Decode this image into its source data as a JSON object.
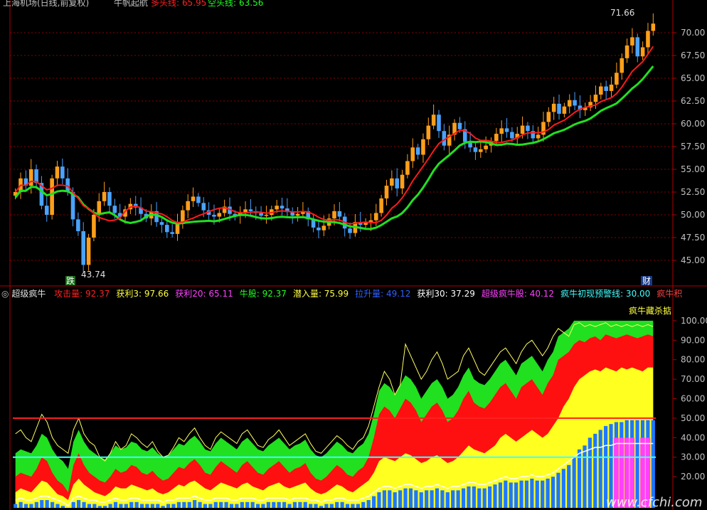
{
  "header": {
    "title": "上海机场(日线,前复权)",
    "indicator": "牛帆起航",
    "bull_label": "多头线:",
    "bull_value": "65.95",
    "bear_label": "空头线:",
    "bear_value": "63.56"
  },
  "sub_header": {
    "name": "超级疯牛",
    "items": [
      {
        "label": "攻击量:",
        "value": "92.37",
        "color": "#ff2020"
      },
      {
        "label": "获利3:",
        "value": "97.66",
        "color": "#ffff40"
      },
      {
        "label": "获利20:",
        "value": "65.11",
        "color": "#ff40ff"
      },
      {
        "label": "牛股:",
        "value": "92.37",
        "color": "#20ff20"
      },
      {
        "label": "潜入量:",
        "value": "75.99",
        "color": "#ffff40"
      },
      {
        "label": "拉升量:",
        "value": "49.12",
        "color": "#3060ff"
      },
      {
        "label": "获利30:",
        "value": "37.29",
        "color": "#ffffff"
      },
      {
        "label": "超级疯牛股:",
        "value": "40.12",
        "color": "#ff40ff"
      },
      {
        "label": "疯牛初现预警线:",
        "value": "30.00",
        "color": "#40ffff"
      },
      {
        "label": "疯牛积",
        "value": "",
        "color": "#ff4040"
      }
    ]
  },
  "annotations": {
    "high_label": "71.66",
    "low_label": "43.74",
    "die_marker": "跌",
    "cai_marker": "财",
    "sub_marker": "疯牛藏杀掂",
    "watermark": "www.cfchi.com"
  },
  "colors": {
    "up": "#ff9f1a",
    "down": "#4aa3ff",
    "bull": "#ff1a1a",
    "bear": "#20e020",
    "grid": "#8a0000",
    "axis": "#b00000"
  },
  "chart_data": [
    {
      "type": "candlestick",
      "title": "上海机场(日线,前复权)",
      "y_ticks": [
        "45.00",
        "47.50",
        "50.00",
        "52.50",
        "55.00",
        "57.50",
        "60.00",
        "62.50",
        "65.00",
        "67.50",
        "70.00"
      ],
      "ylim": [
        42.5,
        72.5
      ],
      "grid": true,
      "close": [
        52.5,
        54.0,
        53.2,
        55.0,
        53.5,
        51.0,
        50.0,
        54.0,
        55.3,
        54.0,
        52.5,
        49.5,
        48.2,
        44.5,
        47.5,
        50.0,
        51.5,
        52.5,
        51.0,
        50.2,
        49.8,
        50.6,
        51.2,
        50.8,
        50.1,
        49.6,
        50.4,
        49.2,
        48.9,
        48.1,
        47.9,
        49.0,
        50.5,
        51.5,
        52.0,
        51.3,
        50.5,
        50.0,
        49.8,
        50.2,
        50.9,
        50.1,
        49.9,
        50.3,
        50.6,
        50.4,
        50.2,
        49.9,
        50.0,
        50.6,
        51.0,
        50.7,
        50.3,
        49.9,
        50.1,
        50.4,
        49.5,
        48.6,
        48.3,
        48.8,
        49.6,
        50.4,
        49.8,
        48.5,
        48.0,
        49.2,
        48.9,
        49.1,
        49.4,
        50.2,
        51.8,
        53.2,
        54.0,
        52.9,
        54.4,
        55.9,
        57.4,
        56.6,
        58.3,
        59.8,
        61.0,
        59.2,
        57.6,
        58.8,
        60.1,
        59.4,
        58.0,
        57.4,
        56.9,
        57.2,
        57.6,
        58.1,
        58.9,
        59.5,
        59.1,
        58.4,
        58.9,
        59.8,
        59.2,
        58.4,
        58.8,
        60.2,
        61.3,
        62.2,
        61.1,
        61.9,
        62.6,
        62.0,
        61.5,
        61.8,
        62.4,
        63.2,
        64.1,
        63.6,
        64.3,
        65.6,
        67.2,
        68.6,
        69.5,
        67.4,
        68.4,
        70.2,
        71.0
      ],
      "bull_line_last": 65.95,
      "bear_line_last": 63.56,
      "high_marker": 71.66,
      "low_marker": 43.74
    },
    {
      "type": "area",
      "title": "超级疯牛",
      "y_ticks": [
        "20.00",
        "30.00",
        "40.00",
        "50.00",
        "60.00",
        "70.00",
        "80.00",
        "90.00",
        "100.00"
      ],
      "ylim": [
        4,
        112
      ],
      "reference_lines": [
        {
          "name": "50",
          "value": 50,
          "color": "#ff2020"
        },
        {
          "name": "疯牛初现预警线",
          "value": 30,
          "color": "#40ffff"
        }
      ],
      "series": [
        {
          "name": "获利3",
          "values": [
            42,
            44,
            40,
            38,
            45,
            52,
            48,
            40,
            36,
            34,
            32,
            44,
            50,
            42,
            38,
            36,
            30,
            28,
            32,
            38,
            34,
            36,
            42,
            40,
            37,
            35,
            38,
            33,
            30,
            31,
            35,
            40,
            38,
            42,
            45,
            40,
            36,
            34,
            40,
            43,
            41,
            39,
            37,
            42,
            44,
            40,
            36,
            35,
            39,
            41,
            44,
            40,
            36,
            38,
            40,
            42,
            37,
            33,
            32,
            35,
            38,
            41,
            39,
            36,
            34,
            38,
            40,
            46,
            56,
            66,
            74,
            70,
            62,
            67,
            88,
            82,
            76,
            70,
            74,
            80,
            84,
            78,
            70,
            72,
            74,
            82,
            86,
            80,
            74,
            72,
            76,
            80,
            84,
            86,
            82,
            78,
            84,
            88,
            90,
            86,
            82,
            86,
            92,
            96,
            94,
            92,
            98,
            99,
            97,
            98,
            97,
            98,
            99,
            97,
            98,
            97,
            98,
            97,
            98,
            97,
            98,
            97
          ]
        },
        {
          "name": "牛股",
          "values": [
            20,
            22,
            21,
            20,
            24,
            30,
            28,
            22,
            18,
            16,
            12,
            26,
            32,
            26,
            22,
            20,
            18,
            17,
            20,
            24,
            22,
            23,
            26,
            25,
            22,
            21,
            23,
            20,
            18,
            19,
            22,
            25,
            24,
            27,
            29,
            26,
            22,
            21,
            25,
            28,
            26,
            24,
            22,
            26,
            28,
            25,
            22,
            21,
            24,
            26,
            28,
            25,
            22,
            24,
            25,
            27,
            22,
            19,
            18,
            20,
            23,
            26,
            24,
            21,
            20,
            23,
            25,
            30,
            40,
            52,
            56,
            54,
            50,
            55,
            60,
            58,
            54,
            48,
            52,
            56,
            58,
            54,
            48,
            50,
            54,
            60,
            64,
            58,
            56,
            55,
            58,
            62,
            66,
            68,
            64,
            60,
            66,
            68,
            70,
            66,
            62,
            68,
            72,
            80,
            82,
            84,
            88,
            90,
            89,
            91,
            92,
            90,
            93,
            92,
            91,
            92,
            93,
            92,
            91,
            92,
            93,
            92
          ]
        },
        {
          "name": "潜入量",
          "values": [
            12,
            14,
            13,
            12,
            15,
            18,
            17,
            14,
            11,
            10,
            8,
            16,
            19,
            16,
            14,
            12,
            11,
            10,
            12,
            15,
            14,
            14,
            16,
            15,
            14,
            13,
            14,
            12,
            11,
            12,
            14,
            16,
            15,
            17,
            18,
            16,
            14,
            13,
            15,
            17,
            16,
            15,
            14,
            16,
            17,
            15,
            14,
            13,
            15,
            16,
            17,
            15,
            14,
            15,
            16,
            17,
            14,
            12,
            11,
            12,
            14,
            16,
            15,
            13,
            12,
            14,
            16,
            18,
            22,
            28,
            30,
            29,
            28,
            30,
            32,
            31,
            29,
            27,
            28,
            30,
            31,
            29,
            27,
            28,
            30,
            33,
            36,
            34,
            33,
            32,
            34,
            36,
            40,
            42,
            40,
            38,
            40,
            42,
            44,
            42,
            40,
            42,
            46,
            50,
            56,
            60,
            66,
            70,
            72,
            74,
            75,
            74,
            76,
            75,
            74,
            76,
            75,
            76,
            75,
            74,
            76,
            76
          ]
        },
        {
          "name": "拉升量",
          "values": [
            6,
            7,
            6,
            6,
            7,
            8,
            8,
            7,
            6,
            5,
            4,
            7,
            8,
            7,
            6,
            6,
            5,
            5,
            6,
            7,
            6,
            6,
            7,
            7,
            6,
            6,
            6,
            6,
            5,
            6,
            6,
            7,
            7,
            7,
            8,
            7,
            6,
            6,
            7,
            7,
            7,
            6,
            6,
            7,
            7,
            7,
            6,
            6,
            7,
            7,
            7,
            7,
            6,
            7,
            7,
            7,
            6,
            6,
            5,
            6,
            6,
            7,
            7,
            6,
            6,
            6,
            7,
            8,
            10,
            12,
            13,
            13,
            12,
            13,
            14,
            14,
            13,
            12,
            13,
            13,
            14,
            13,
            12,
            13,
            13,
            14,
            15,
            15,
            14,
            14,
            15,
            16,
            17,
            18,
            17,
            17,
            18,
            18,
            19,
            18,
            18,
            19,
            20,
            22,
            24,
            26,
            30,
            34,
            36,
            40,
            42,
            44,
            46,
            47,
            48,
            48,
            49,
            49,
            49,
            49,
            49,
            49
          ]
        },
        {
          "name": "获利30",
          "values": [
            8,
            9,
            8,
            8,
            9,
            10,
            10,
            9,
            8,
            7,
            5,
            9,
            10,
            9,
            8,
            8,
            7,
            7,
            8,
            9,
            8,
            8,
            9,
            9,
            8,
            8,
            8,
            8,
            7,
            8,
            8,
            9,
            9,
            9,
            10,
            9,
            8,
            8,
            9,
            9,
            9,
            8,
            8,
            9,
            9,
            9,
            8,
            8,
            9,
            9,
            9,
            9,
            8,
            9,
            9,
            9,
            8,
            8,
            7,
            8,
            8,
            9,
            9,
            8,
            8,
            8,
            9,
            10,
            12,
            14,
            15,
            15,
            14,
            15,
            16,
            16,
            15,
            14,
            15,
            15,
            16,
            15,
            14,
            15,
            15,
            16,
            17,
            17,
            16,
            16,
            17,
            18,
            19,
            20,
            19,
            19,
            20,
            20,
            21,
            20,
            20,
            21,
            22,
            24,
            26,
            28,
            30,
            32,
            33,
            34,
            35,
            35,
            36,
            36,
            37,
            37,
            37,
            37,
            37,
            37,
            37,
            37
          ]
        }
      ]
    }
  ]
}
